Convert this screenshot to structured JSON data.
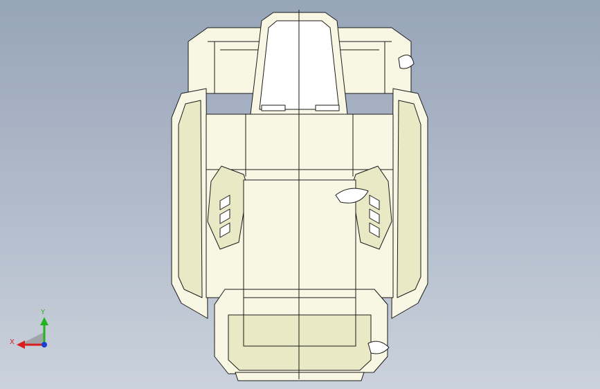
{
  "viewport": {
    "background_top": "#97a5b9",
    "background_bottom": "#cbd2dc"
  },
  "model": {
    "fill": "#f7f7e3",
    "shade": "#e9e9c6",
    "edge": "#1a1a1a"
  },
  "triad": {
    "x_label": "X",
    "y_label": "Y",
    "x_color": "#d81e1e",
    "y_color": "#21b521",
    "z_color": "#1a3fd1"
  }
}
